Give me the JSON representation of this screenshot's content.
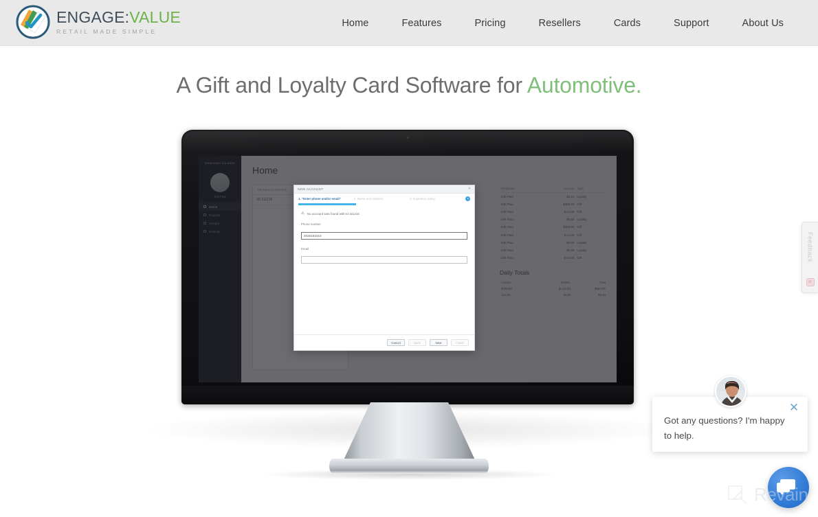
{
  "header": {
    "logo": {
      "title_dark": "ENGAGE:",
      "title_green": "VALUE",
      "tagline": "RETAIL MADE SIMPLE",
      "icon": "engage-value-circle-check-logo"
    },
    "nav": [
      {
        "label": "Home"
      },
      {
        "label": "Features"
      },
      {
        "label": "Pricing"
      },
      {
        "label": "Resellers"
      },
      {
        "label": "Cards"
      },
      {
        "label": "Support"
      },
      {
        "label": "About Us"
      }
    ],
    "bg_color": "#e9e9e9"
  },
  "hero": {
    "headline_main": "A Gift and Loyalty Card Software for",
    "headline_accent": "Automotive.",
    "accent_color": "#7fbf7b",
    "text_color": "#6d6d6d"
  },
  "screenshot_app": {
    "sidebar": {
      "location": "Downtown Location",
      "user_name": "Erik Paul",
      "avatar": "user-avatar",
      "items": [
        {
          "label": "Home",
          "icon": "home-icon",
          "active": true
        },
        {
          "label": "Reports",
          "icon": "reports-icon",
          "active": false
        },
        {
          "label": "Groups",
          "icon": "groups-icon",
          "active": false
        },
        {
          "label": "Settings",
          "icon": "settings-icon",
          "active": false
        }
      ]
    },
    "page_title": "Home",
    "transactions": {
      "header": "TRANSACTIONS",
      "rows": [
        "ID  111216"
      ]
    },
    "employee_table": {
      "columns": [
        "Employee",
        "Amount",
        "Type"
      ],
      "rows": [
        {
          "employee": "Erik Paul",
          "amount": "$2.10",
          "type": "Loyalty"
        },
        {
          "employee": "Erik Paul",
          "amount": "$200.00",
          "type": "Gift"
        },
        {
          "employee": "Erik Paul",
          "amount": "$-12.00",
          "type": "Gift"
        },
        {
          "employee": "Erik Paul",
          "amount": "$5.00",
          "type": "Loyalty"
        },
        {
          "employee": "Erik Paul",
          "amount": "$200.00",
          "type": "Gift"
        },
        {
          "employee": "Erik Paul",
          "amount": "$-12.00",
          "type": "Gift"
        },
        {
          "employee": "Erik Paul",
          "amount": "$3.00",
          "type": "Loyalty"
        },
        {
          "employee": "Erik Paul",
          "amount": "$5.00",
          "type": "Loyalty"
        },
        {
          "employee": "Erik Paul",
          "amount": "$-12.00",
          "type": "Gift"
        }
      ]
    },
    "daily_totals": {
      "title": "Daily Totals",
      "columns": [
        "Credits:",
        "Debits:",
        "Total"
      ],
      "rows": [
        {
          "credits": "$700.00",
          "debits": "$-112.33",
          "total": "$587.67"
        },
        {
          "credits": "112.33",
          "debits": "16.00",
          "total": "96.33"
        }
      ]
    },
    "modal": {
      "title": "NEW ACCOUNT",
      "close_icon": "close-icon",
      "help_icon": "help-icon",
      "steps": [
        {
          "label": "1. \"Enter phone and/or email\"",
          "active": true
        },
        {
          "label": "2. Name and Address",
          "active": false
        },
        {
          "label": "3. Expiration policy",
          "active": false
        }
      ],
      "alert_icon": "warning-icon",
      "alert_text": "No account was found with Id 111216",
      "fields": [
        {
          "label": "Phone number",
          "value": "2025151010",
          "placeholder": ""
        },
        {
          "label": "Email",
          "value": "",
          "placeholder": ""
        }
      ],
      "buttons": [
        {
          "label": "Cancel",
          "disabled": false
        },
        {
          "label": "Back",
          "disabled": true
        },
        {
          "label": "Next",
          "disabled": false
        },
        {
          "label": "Finish",
          "disabled": true
        }
      ],
      "progress_color": "#45b4e8"
    }
  },
  "feedback_tab": {
    "label": "Feedback",
    "icon": "smiley-face-icon"
  },
  "chat": {
    "message": "Got any questions? I'm happy to help.",
    "close_icon": "close-icon",
    "avatar": "agent-photo-avatar",
    "launcher_icon": "chat-bubbles-icon",
    "launcher_color": "#2f7ad6"
  },
  "watermark": {
    "text": "Revain",
    "icon": "revain-logo-icon"
  }
}
